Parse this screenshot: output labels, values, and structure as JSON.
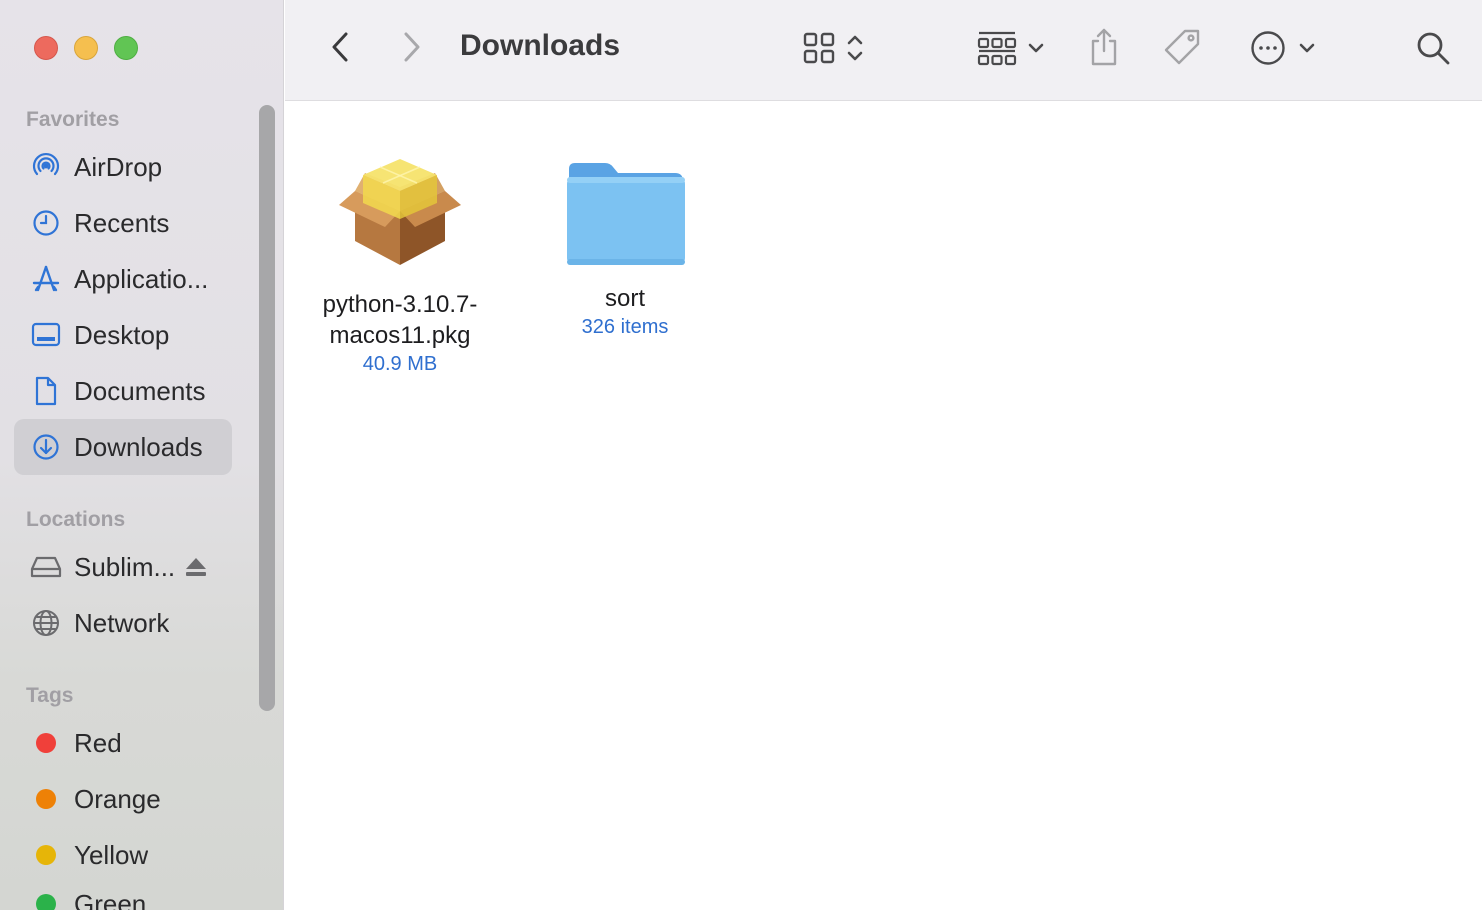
{
  "window": {
    "title": "Downloads"
  },
  "sidebar": {
    "favorites_title": "Favorites",
    "favorites": [
      {
        "label": "AirDrop",
        "icon": "airdrop-icon"
      },
      {
        "label": "Recents",
        "icon": "clock-icon"
      },
      {
        "label": "Applicatio...",
        "icon": "applications-icon"
      },
      {
        "label": "Desktop",
        "icon": "desktop-icon"
      },
      {
        "label": "Documents",
        "icon": "document-icon"
      },
      {
        "label": "Downloads",
        "icon": "download-icon",
        "selected": true
      }
    ],
    "locations_title": "Locations",
    "locations": [
      {
        "label": "Sublim...",
        "icon": "drive-icon",
        "eject": true
      },
      {
        "label": "Network",
        "icon": "globe-icon"
      }
    ],
    "tags_title": "Tags",
    "tags": [
      {
        "label": "Red",
        "color": "#f0403a"
      },
      {
        "label": "Orange",
        "color": "#ee8106"
      },
      {
        "label": "Yellow",
        "color": "#e6b508"
      },
      {
        "label": "Green",
        "color": "#2bb24a"
      }
    ]
  },
  "files": [
    {
      "name_line1": "python-3.10.7-",
      "name_line2": "macos11.pkg",
      "meta": "40.9 MB",
      "icon": "package-icon"
    },
    {
      "name_line1": "sort",
      "name_line2": "",
      "meta": "326 items",
      "icon": "folder-icon"
    }
  ],
  "colors": {
    "accent": "#2f6fcf",
    "sidebar_icon": "#2f74d6",
    "folder": "#7cc2f2"
  }
}
